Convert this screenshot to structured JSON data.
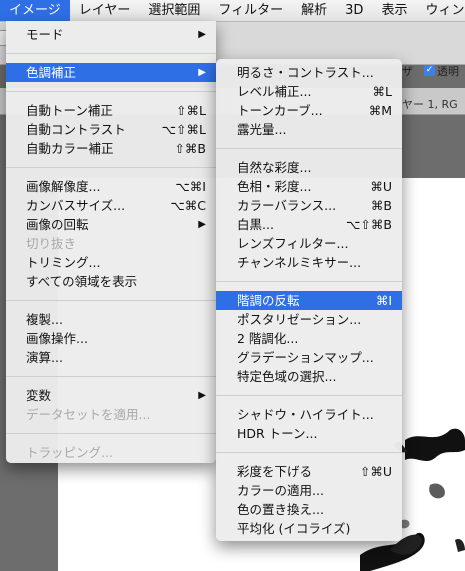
{
  "menubar": {
    "items": [
      "イメージ",
      "レイヤー",
      "選択範囲",
      "フィルター",
      "解析",
      "3D",
      "表示",
      "ウィン"
    ]
  },
  "background": {
    "options_sa": "ザ",
    "options_transparent": "透明",
    "check_mark": "✓",
    "tab_text": "ヤー 1, RG"
  },
  "main_menu": {
    "mode": "モード",
    "adjust": "色調補正",
    "auto_tone": {
      "label": "自動トーン補正",
      "shortcut": "⇧⌘L"
    },
    "auto_contrast": {
      "label": "自動コントラスト",
      "shortcut": "⌥⇧⌘L"
    },
    "auto_color": {
      "label": "自動カラー補正",
      "shortcut": "⇧⌘B"
    },
    "image_size": {
      "label": "画像解像度...",
      "shortcut": "⌥⌘I"
    },
    "canvas_size": {
      "label": "カンバスサイズ...",
      "shortcut": "⌥⌘C"
    },
    "rotation": "画像の回転",
    "crop": "切り抜き",
    "trim": "トリミング...",
    "reveal_all": "すべての領域を表示",
    "duplicate": "複製...",
    "apply_image": "画像操作...",
    "calculations": "演算...",
    "variables": "変数",
    "apply_dataset": "データセットを適用...",
    "trapping": "トラッピング..."
  },
  "sub_menu": {
    "brightness": {
      "label": "明るさ・コントラスト..."
    },
    "levels": {
      "label": "レベル補正...",
      "shortcut": "⌘L"
    },
    "curves": {
      "label": "トーンカーブ...",
      "shortcut": "⌘M"
    },
    "exposure": {
      "label": "露光量..."
    },
    "vibrance": {
      "label": "自然な彩度..."
    },
    "hue_sat": {
      "label": "色相・彩度...",
      "shortcut": "⌘U"
    },
    "color_balance": {
      "label": "カラーバランス...",
      "shortcut": "⌘B"
    },
    "bw": {
      "label": "白黒...",
      "shortcut": "⌥⇧⌘B"
    },
    "photo_filter": {
      "label": "レンズフィルター..."
    },
    "channel_mixer": {
      "label": "チャンネルミキサー..."
    },
    "invert": {
      "label": "階調の反転",
      "shortcut": "⌘I"
    },
    "posterize": {
      "label": "ポスタリゼーション..."
    },
    "threshold": {
      "label": "2 階調化..."
    },
    "gradient_map": {
      "label": "グラデーションマップ..."
    },
    "selective_color": {
      "label": "特定色域の選択..."
    },
    "shadows_highlights": {
      "label": "シャドウ・ハイライト..."
    },
    "hdr_toning": {
      "label": "HDR トーン..."
    },
    "desaturate": {
      "label": "彩度を下げる",
      "shortcut": "⇧⌘U"
    },
    "match_color": {
      "label": "カラーの適用..."
    },
    "replace_color": {
      "label": "色の置き換え..."
    },
    "equalize": {
      "label": "平均化 (イコライズ)"
    }
  },
  "icons": {
    "submenu_arrow": "▶"
  },
  "colors": {
    "accent": "#2f6fe6"
  }
}
